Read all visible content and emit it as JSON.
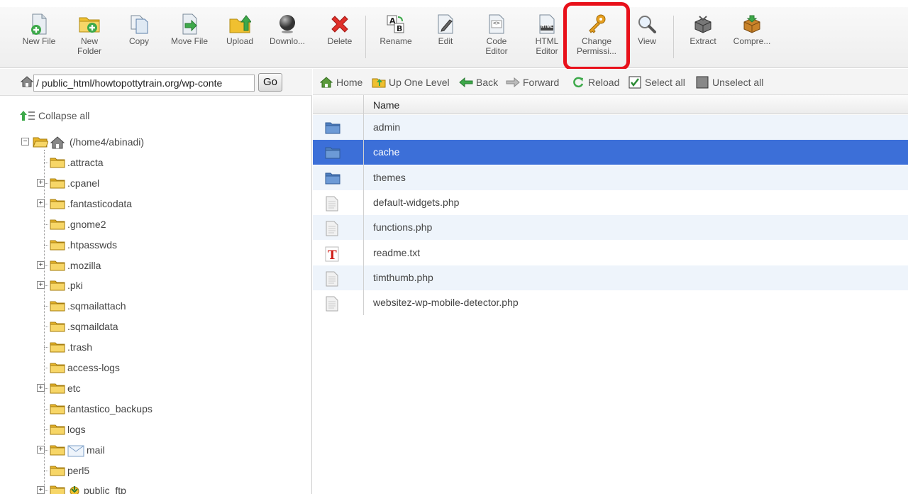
{
  "toolbar": {
    "buttons": [
      {
        "id": "new-file",
        "label": "New File",
        "icon": "new-file-icon"
      },
      {
        "id": "new-folder",
        "label": "New\nFolder",
        "icon": "new-folder-icon"
      },
      {
        "id": "copy",
        "label": "Copy",
        "icon": "copy-icon"
      },
      {
        "id": "move-file",
        "label": "Move File",
        "icon": "move-file-icon"
      },
      {
        "id": "upload",
        "label": "Upload",
        "icon": "upload-icon"
      },
      {
        "id": "download",
        "label": "Downlo...",
        "icon": "download-icon"
      },
      {
        "id": "delete",
        "label": "Delete",
        "icon": "delete-icon"
      },
      {
        "id": "rename",
        "label": "Rename",
        "icon": "rename-icon"
      },
      {
        "id": "edit",
        "label": "Edit",
        "icon": "edit-icon"
      },
      {
        "id": "code-editor",
        "label": "Code\nEditor",
        "icon": "code-editor-icon"
      },
      {
        "id": "html-editor",
        "label": "HTML\nEditor",
        "icon": "html-editor-icon"
      },
      {
        "id": "change-permissions",
        "label": "Change\nPermissi...",
        "icon": "key-icon"
      },
      {
        "id": "view",
        "label": "View",
        "icon": "magnifier-icon"
      },
      {
        "id": "extract",
        "label": "Extract",
        "icon": "extract-icon"
      },
      {
        "id": "compress",
        "label": "Compre...",
        "icon": "compress-icon"
      }
    ],
    "html_icon_text": "HTML",
    "code_icon_text": "<>"
  },
  "path": {
    "value": "/ public_html/howtopottytrain.org/wp-conte",
    "go_label": "Go"
  },
  "tree": {
    "collapse_label": "Collapse all",
    "root_label": "(/home4/abinadi)",
    "items": [
      {
        "label": ".attracta",
        "expandable": false
      },
      {
        "label": ".cpanel",
        "expandable": true
      },
      {
        "label": ".fantasticodata",
        "expandable": true
      },
      {
        "label": ".gnome2",
        "expandable": false
      },
      {
        "label": ".htpasswds",
        "expandable": false
      },
      {
        "label": ".mozilla",
        "expandable": true
      },
      {
        "label": ".pki",
        "expandable": true
      },
      {
        "label": ".sqmailattach",
        "expandable": false
      },
      {
        "label": ".sqmaildata",
        "expandable": false
      },
      {
        "label": ".trash",
        "expandable": false
      },
      {
        "label": "access-logs",
        "expandable": false
      },
      {
        "label": "etc",
        "expandable": true
      },
      {
        "label": "fantastico_backups",
        "expandable": false
      },
      {
        "label": "logs",
        "expandable": false
      },
      {
        "label": "mail",
        "expandable": true
      },
      {
        "label": "perl5",
        "expandable": false
      },
      {
        "label": "public_ftp",
        "expandable": true
      }
    ]
  },
  "nav": {
    "home": "Home",
    "up": "Up One Level",
    "back": "Back",
    "forward": "Forward",
    "reload": "Reload",
    "select_all": "Select all",
    "unselect_all": "Unselect all"
  },
  "files": {
    "column_name": "Name",
    "rows": [
      {
        "name": "admin",
        "type": "folder",
        "selected": false
      },
      {
        "name": "cache",
        "type": "folder",
        "selected": true
      },
      {
        "name": "themes",
        "type": "folder",
        "selected": false
      },
      {
        "name": "default-widgets.php",
        "type": "file",
        "selected": false
      },
      {
        "name": "functions.php",
        "type": "file",
        "selected": false
      },
      {
        "name": "readme.txt",
        "type": "text",
        "selected": false
      },
      {
        "name": "timthumb.php",
        "type": "file",
        "selected": false
      },
      {
        "name": "websitez-wp-mobile-detector.php",
        "type": "file",
        "selected": false
      }
    ]
  },
  "colors": {
    "selection": "#3c6fd8",
    "highlight_box": "#e8101a",
    "folder_yellow": "#f0c030",
    "folder_blue": "#5b8ccc"
  }
}
